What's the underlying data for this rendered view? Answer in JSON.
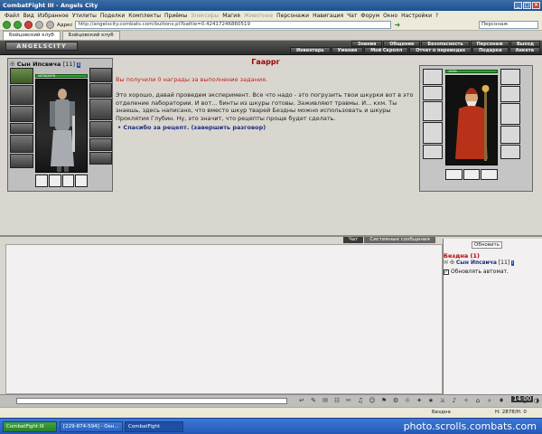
{
  "window": {
    "title": "CombatFight III - Angels City"
  },
  "menu": {
    "items": [
      "Файл",
      "Вид",
      "Избранное",
      "Утилиты",
      "Поделки",
      "Комплекты",
      "Приёмы",
      "Элексиры",
      "Магия",
      "Животное",
      "Персонажи",
      "Навигация",
      "Чат",
      "Форум",
      "Окно",
      "Настройки",
      "?"
    ],
    "dimmed": [
      "Элексиры",
      "Животное"
    ]
  },
  "toolbar": {
    "address_label": "Адрес",
    "address": "http://angelscity.combats.com/buttons.pl?battle=0.42417246860519",
    "search_label": "Персонаж"
  },
  "tabs": [
    {
      "label": "Бойцовский клуб"
    },
    {
      "label": "Бойцовский клуб"
    }
  ],
  "header": {
    "logo": "ANGELSCITY",
    "nav_top": [
      "Знания",
      "Общение",
      "Безопасность",
      "Персонаж",
      "Выход"
    ],
    "nav_bottom": [
      "Инвентарь",
      "Умения",
      "Мой Скролл",
      "Отчет о переводах",
      "Подарки",
      "Анкета"
    ]
  },
  "character": {
    "name": "Сын Ипсвича",
    "level": "[11]",
    "hp": "2878/2878"
  },
  "npc": {
    "name": "Гааррг",
    "hp": "100%"
  },
  "dialog": {
    "reward": "Вы получили 0 награды за выполнение задания.",
    "text": "Это хорошо, давай проведем эксперимент. Все что надо - это погрузить твои шкурки вот в это отделение лаборатории. И вот... бинты из шкуры готовы. Заживляют травмы. И... кхм. Ты знаешь, здесь написано, что вместо шкур тварей Бездны можно использовать и шкуры Проклятия Глубин. Ну, это значит, что рецепты проще будет сделать.",
    "thanks": "• Спасибо за рецепт. (завершить разговор)"
  },
  "chat": {
    "tabs": [
      "Чат",
      "Системные сообщения"
    ]
  },
  "users": {
    "refresh_button": "Обновить",
    "location": "Бездна (1)",
    "user": "Сын Ипсвича",
    "user_level": "[11]",
    "auto_refresh": "Обновлять автомат."
  },
  "statusbar": {
    "left": "Бездна",
    "hp": "Н: 2878/Н: 0"
  },
  "clock": "14:00",
  "taskbar": {
    "tasks": [
      "CombatFight III",
      "[229-874-594] - Окн...",
      "CombatFight"
    ]
  },
  "watermark": "photo.scrolls.combats.com",
  "chat_icons": [
    "↵",
    "✎",
    "✉",
    "☷",
    "✂",
    "♫",
    "☺",
    "⚑",
    "⚙",
    "☼",
    "✦",
    "★",
    "⚔",
    "♪",
    "✧",
    "⌂",
    "⌕",
    "♦",
    "⚐",
    "◐",
    "◑",
    "▣",
    "✖"
  ]
}
